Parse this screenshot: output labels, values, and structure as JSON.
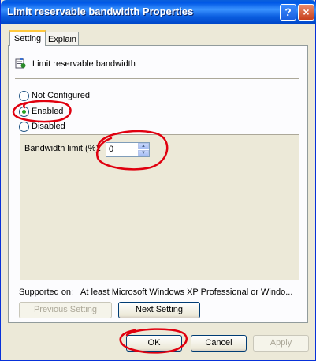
{
  "window": {
    "title": "Limit reservable bandwidth Properties"
  },
  "titlebar_buttons": {
    "help": "?",
    "close": "×"
  },
  "tabs": [
    {
      "label": "Setting",
      "selected": true
    },
    {
      "label": "Explain",
      "selected": false
    }
  ],
  "policy": {
    "name": "Limit reservable bandwidth",
    "icon": "policy-icon"
  },
  "options": [
    {
      "label": "Not Configured",
      "checked": false
    },
    {
      "label": "Enabled",
      "checked": true
    },
    {
      "label": "Disabled",
      "checked": false
    }
  ],
  "bandwidth": {
    "label": "Bandwidth limit (%):",
    "value": "0"
  },
  "supported": {
    "label": "Supported on:",
    "value": "At least Microsoft Windows XP Professional or Windo..."
  },
  "buttons": {
    "previous": "Previous Setting",
    "next": "Next Setting",
    "ok": "OK",
    "cancel": "Cancel",
    "apply": "Apply"
  },
  "colors": {
    "title_bar": "#0058e6",
    "dialog_bg": "#ece9d8",
    "annotation": "#e0000f"
  }
}
